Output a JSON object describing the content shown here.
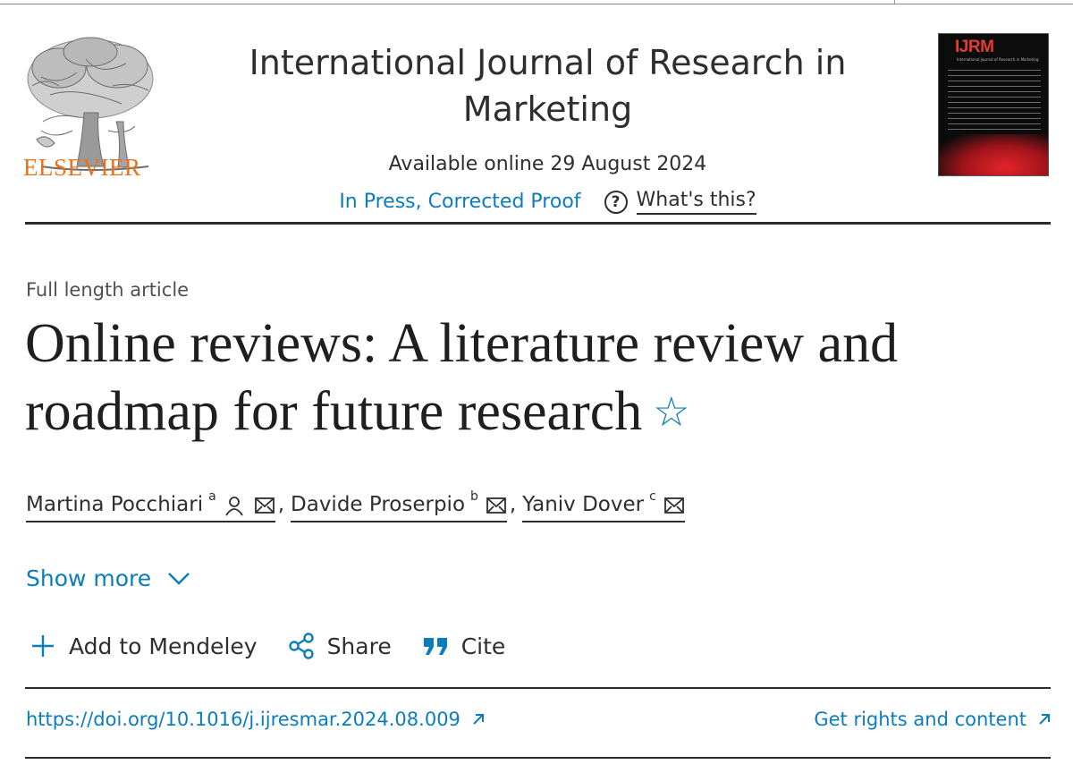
{
  "publisher": {
    "name": "ELSEVIER"
  },
  "journal": {
    "title": "International Journal of Research in Marketing",
    "available_online": "Available online 29 August 2024",
    "status": "In Press, Corrected Proof",
    "whats_this": "What's this?",
    "cover": {
      "brand": "IJRM",
      "subtitle": "International Journal of Research in Marketing"
    }
  },
  "article": {
    "type": "Full length article",
    "title": "Online reviews: A literature review and roadmap for future research",
    "authors": [
      {
        "name": "Martina Pocchiari",
        "affiliation": "a"
      },
      {
        "name": "Davide Proserpio",
        "affiliation": "b"
      },
      {
        "name": "Yaniv Dover",
        "affiliation": "c"
      }
    ],
    "show_more": "Show more"
  },
  "actions": {
    "add_to_mendeley": "Add to Mendeley",
    "share": "Share",
    "cite": "Cite"
  },
  "footer": {
    "doi": "https://doi.org/10.1016/j.ijresmar.2024.08.009",
    "rights": "Get rights and content"
  },
  "colors": {
    "link": "#0c7dbb",
    "elsevier_orange": "#e9711c",
    "text": "#2e2e2e"
  }
}
